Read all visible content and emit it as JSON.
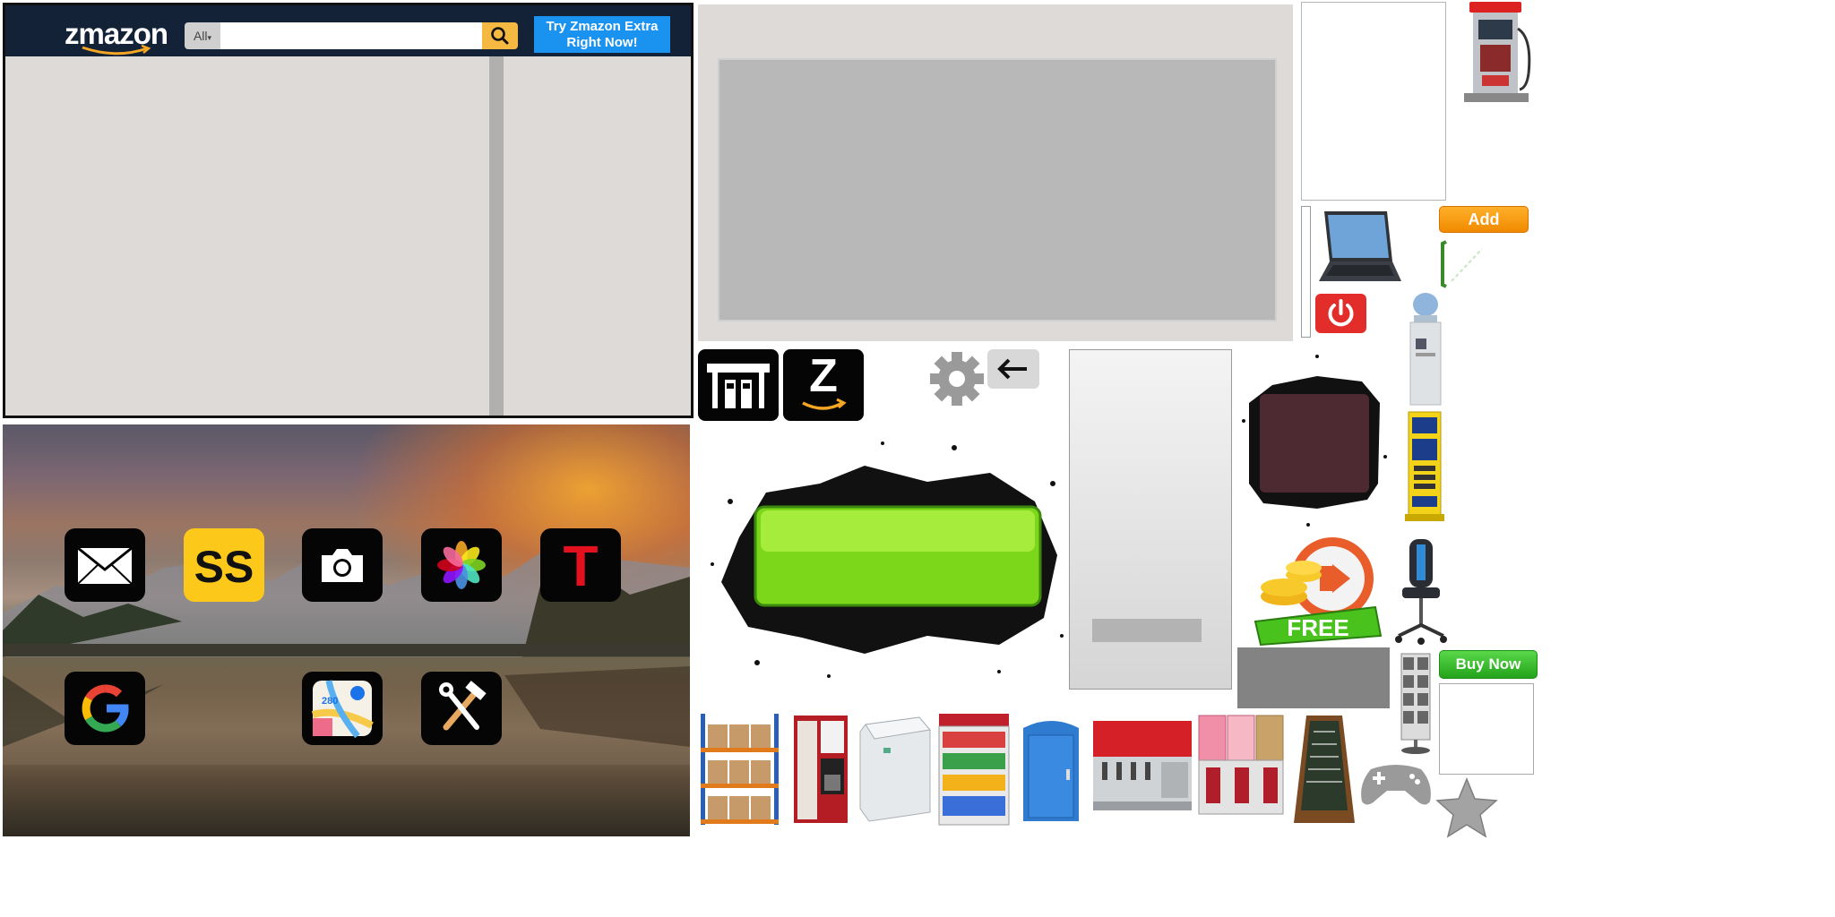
{
  "zmazon": {
    "logo": "zmazon",
    "search_category": "All",
    "search_placeholder": "",
    "promo_label": "Try Zmazon Extra Right Now!"
  },
  "home_screen": {
    "apps": [
      {
        "name": "mail",
        "icon": "envelope-icon"
      },
      {
        "name": "ss",
        "label": "SS",
        "icon": "ss-icon"
      },
      {
        "name": "camera",
        "icon": "camera-icon"
      },
      {
        "name": "photos",
        "icon": "photos-flower-icon"
      },
      {
        "name": "t-app",
        "label": "T",
        "icon": "t-icon"
      },
      {
        "name": "google",
        "icon": "google-g-icon"
      },
      {
        "name": "maps",
        "icon": "maps-icon"
      },
      {
        "name": "tools",
        "icon": "hammer-wrench-icon"
      }
    ],
    "maps_label": "280"
  },
  "toolbar": {
    "z_label": "Z"
  },
  "buttons": {
    "add_label": "Add",
    "buynow_label": "Buy Now",
    "free_label": "FREE"
  },
  "colors": {
    "zmazon_header": "#142238",
    "promo_blue": "#1a92f0",
    "search_orange": "#f5b942",
    "add_orange": "#f59b12",
    "buynow_green": "#32b82a",
    "power_red": "#e32d2b",
    "ss_yellow": "#fcc91a"
  },
  "store_items": [
    "shelf",
    "coffee-machine",
    "chest-freezer",
    "snack-rack",
    "portable-toilet",
    "soda-fountain",
    "slushie-machine",
    "chalkboard-sign"
  ]
}
